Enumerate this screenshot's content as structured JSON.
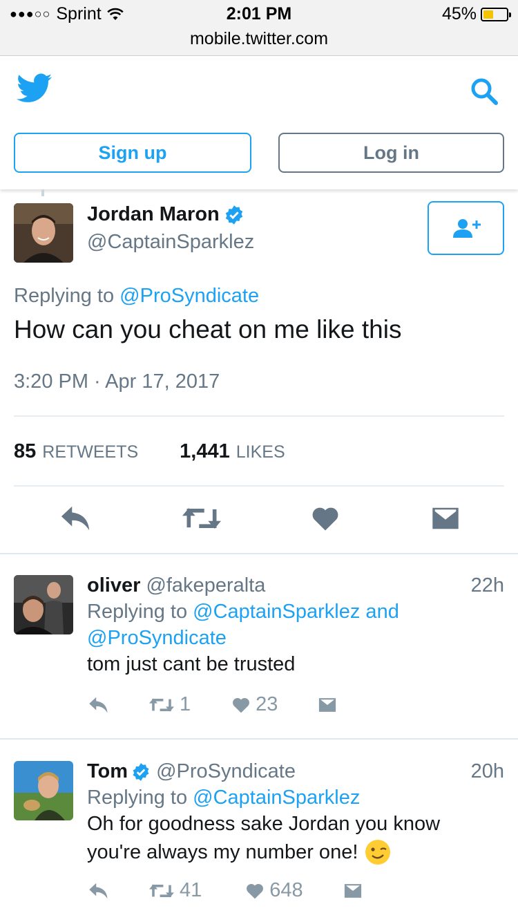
{
  "status_bar": {
    "signal": "●●●○○",
    "carrier": "Sprint",
    "time": "2:01 PM",
    "url": "mobile.twitter.com",
    "battery_percent": "45%",
    "battery_level": 0.45
  },
  "header": {
    "signup_label": "Sign up",
    "login_label": "Log in"
  },
  "main_tweet": {
    "name": "Jordan Maron",
    "handle": "@CaptainSparklez",
    "replying_prefix": "Replying to",
    "replying_to": "@ProSyndicate",
    "text": "How can you cheat on me like this",
    "timestamp": "3:20 PM · Apr 17, 2017",
    "retweets_count": "85",
    "retweets_label": "RETWEETS",
    "likes_count": "1,441",
    "likes_label": "LIKES"
  },
  "replies": [
    {
      "name": "oliver",
      "handle": "@fakeperalta",
      "time": "22h",
      "replying_prefix": "Replying to",
      "replying_to_line1": "@CaptainSparklez and",
      "replying_to_line2": "@ProSyndicate",
      "text_line1": "tom just cant be trusted",
      "retweets": "1",
      "likes": "23"
    },
    {
      "name": "Tom",
      "handle": "@ProSyndicate",
      "time": "20h",
      "replying_prefix": "Replying to",
      "replying_to_line1": "@CaptainSparklez",
      "text_line1": "Oh for goodness sake Jordan you know",
      "text_line2": "you're always my number one!",
      "retweets": "41",
      "likes": "648"
    }
  ],
  "colors": {
    "brand_blue": "#1da1f2",
    "text_grey": "#657786",
    "icon_grey": "#8899a6",
    "main_icon_grey": "#657786"
  }
}
